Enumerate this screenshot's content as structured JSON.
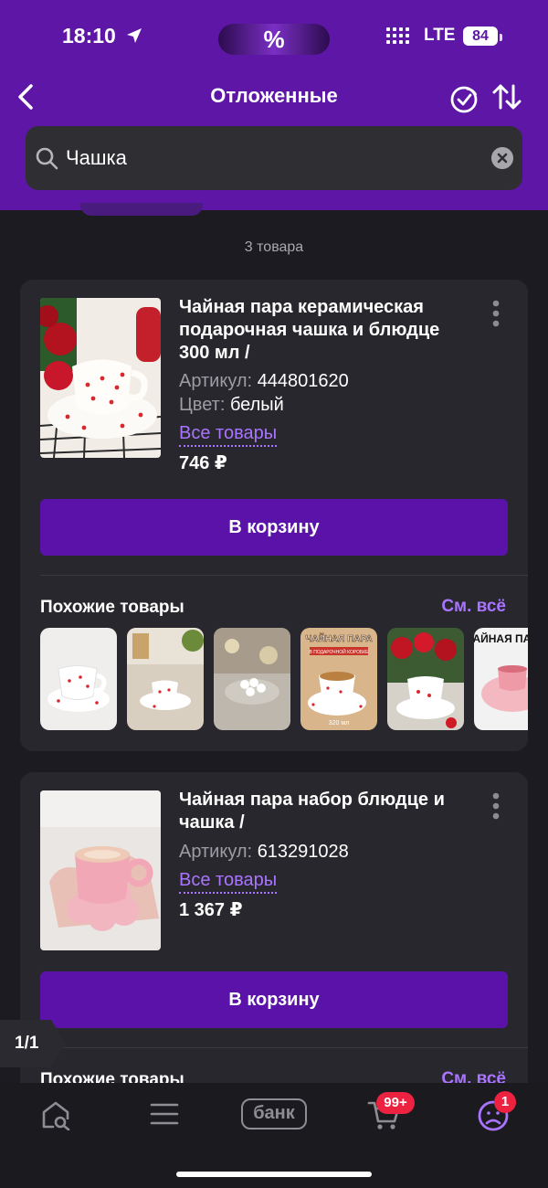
{
  "status_bar": {
    "time": "18:10",
    "promo": "%",
    "network": "LTE",
    "battery": "84"
  },
  "nav": {
    "title": "Отложенные"
  },
  "search": {
    "value": "Чашка"
  },
  "count_label": "3 товара",
  "products": [
    {
      "name": "Чайная пара керамическая подарочная чашка и блюдце 300 мл /",
      "article_label": "Артикул:",
      "article": "444801620",
      "color_label": "Цвет:",
      "color": "белый",
      "all_goods": "Все товары",
      "price": "746 ₽",
      "cart_button": "В корзину",
      "similar_title": "Похожие товары",
      "see_all": "См. всё"
    },
    {
      "name": "Чайная пара набор блюдце и чашка /",
      "article_label": "Артикул:",
      "article": "613291028",
      "all_goods": "Все товары",
      "price": "1 367 ₽",
      "cart_button": "В корзину",
      "similar_title": "Похожие товары",
      "see_all": "См. всё"
    }
  ],
  "similar_thumbs": {
    "t4_caption": "ЧАЙНАЯ ПАРА",
    "t4_sub": "В ПОДАРОЧНОЙ КОРОБКЕ",
    "t4_volume": "320 мл",
    "t6_caption": "ЧАЙНАЯ ПАРА"
  },
  "pager": "1/1",
  "tabbar": {
    "bank_label": "банк",
    "cart_badge": "99+",
    "profile_badge": "1"
  },
  "colors": {
    "brand": "#5d16a5",
    "accent_link": "#a974ff",
    "badge": "#ec2240",
    "button": "#5a12a8"
  }
}
